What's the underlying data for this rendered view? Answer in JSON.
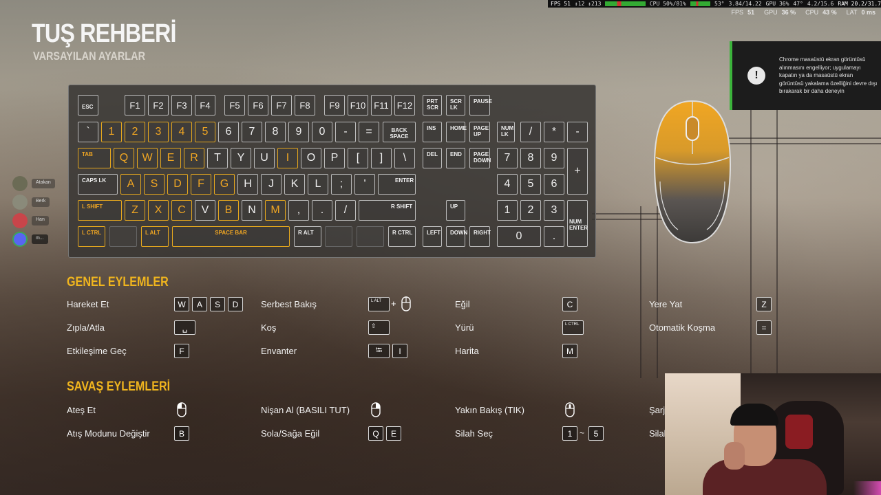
{
  "perf_overlay": {
    "fps": "FPS 51",
    "frametime": "↕12 ↕213",
    "cpu": "CPU 50%/81%",
    "cpu_temp": "53°",
    "clock": "3.84/14.22",
    "gpu": "GPU 36%",
    "gpu_temp": "47°",
    "vram": "4.2/15.6",
    "ram": "RAM 20.2/31.7"
  },
  "stats": [
    {
      "label": "FPS",
      "value": "51"
    },
    {
      "label": "GPU",
      "value": "36 %"
    },
    {
      "label": "CPU",
      "value": "43 %"
    },
    {
      "label": "LAT",
      "value": "0 ms"
    }
  ],
  "title": "TUŞ REHBERİ",
  "subtitle": "VARSAYILAN AYARLAR",
  "notification": {
    "icon": "warning-icon",
    "text": "Chrome masaüstü ekran görüntüsü alınmasını engelliyor; uygulamayı kapatın ya da masaüstü ekran görüntüsü yakalama özelliğini devre dışı bırakarak bir daha deneyin"
  },
  "discord_users": [
    {
      "name": "Atakan"
    },
    {
      "name": "Berk"
    },
    {
      "name": "Han"
    },
    {
      "name": "m..."
    }
  ],
  "keys": {
    "esc": "ESC",
    "f1": "F1",
    "f2": "F2",
    "f3": "F3",
    "f4": "F4",
    "f5": "F5",
    "f6": "F6",
    "f7": "F7",
    "f8": "F8",
    "f9": "F9",
    "f10": "F10",
    "f11": "F11",
    "f12": "F12",
    "prtscr": "PRT SCR",
    "scrlk": "SCR LK",
    "pause": "PAUSE",
    "backtick": "`",
    "n1": "1",
    "n2": "2",
    "n3": "3",
    "n4": "4",
    "n5": "5",
    "n6": "6",
    "n7": "7",
    "n8": "8",
    "n9": "9",
    "n0": "0",
    "minus": "-",
    "equals": "=",
    "backspace": "BACK SPACE",
    "ins": "INS",
    "home": "HOME",
    "pgup": "PAGE UP",
    "numlk": "NUM LK",
    "npslash": "/",
    "npstar": "*",
    "npminus": "-",
    "tab": "TAB",
    "q": "Q",
    "w": "W",
    "e": "E",
    "r": "R",
    "t": "T",
    "y": "Y",
    "u": "U",
    "i": "I",
    "o": "O",
    "p": "P",
    "lbracket": "[",
    "rbracket": "]",
    "backslash": "\\",
    "del": "DEL",
    "end": "END",
    "pgdn": "PAGE DOWN",
    "np7": "7",
    "np8": "8",
    "np9": "9",
    "npplus": "+",
    "capslk": "CAPS LK",
    "a": "A",
    "s": "S",
    "d": "D",
    "f": "F",
    "g": "G",
    "h": "H",
    "j": "J",
    "k": "K",
    "l": "L",
    "semicolon": ";",
    "quote": "'",
    "enter": "ENTER",
    "np4": "4",
    "np5": "5",
    "np6": "6",
    "lshift": "L SHIFT",
    "z": "Z",
    "x": "X",
    "c": "C",
    "v": "V",
    "b": "B",
    "n": "N",
    "m": "M",
    "comma": ",",
    "period": ".",
    "slash": "/",
    "rshift": "R SHIFT",
    "up": "UP",
    "np1": "1",
    "np2": "2",
    "np3": "3",
    "npenter": "NUM ENTER",
    "lctrl": "L CTRL",
    "lalt": "L ALT",
    "space": "SPACE BAR",
    "ralt": "R ALT",
    "rctrl": "R CTRL",
    "left": "LEFT",
    "down": "DOWN",
    "right": "RIGHT",
    "np0": "0",
    "npdot": "."
  },
  "general": {
    "title": "GENEL EYLEMLER",
    "move": "Hareket Et",
    "move_keys": [
      "W",
      "A",
      "S",
      "D"
    ],
    "jump": "Zıpla/Atla",
    "jump_key": "␣",
    "interact": "Etkileşime Geç",
    "interact_key": "F",
    "freelook": "Serbest Bakış",
    "freelook_key": "L ALT",
    "freelook_plus": "+",
    "run": "Koş",
    "run_key": "⇧",
    "inventory": "Envanter",
    "inventory_key": "I",
    "inventory_tab": "⭾",
    "crouch": "Eğil",
    "crouch_key": "C",
    "walk": "Yürü",
    "walk_key": "L CTRL",
    "map": "Harita",
    "map_key": "M",
    "prone": "Yere Yat",
    "prone_key": "Z",
    "autorun": "Otomatik Koşma",
    "autorun_key": "="
  },
  "combat": {
    "title": "SAVAŞ EYLEMLERİ",
    "fire": "Ateş Et",
    "firemode": "Atış Modunu Değiştir",
    "firemode_key": "B",
    "aim": "Nişan Al (BASILI TUT)",
    "lean": "Sola/Sağa Eğil",
    "lean_keys": [
      "Q",
      "E"
    ],
    "closelook": "Yakın Bakış (TIK)",
    "weapon": "Silah Seç",
    "weapon_from": "1",
    "weapon_tilde": "~",
    "weapon_to": "5",
    "reload_partial": "Şarj",
    "weapon_partial": "Silah"
  },
  "colors": {
    "accent": "#f0b51e",
    "highlight_key": "#e6a81e",
    "toast_accent": "#3bb33b"
  }
}
